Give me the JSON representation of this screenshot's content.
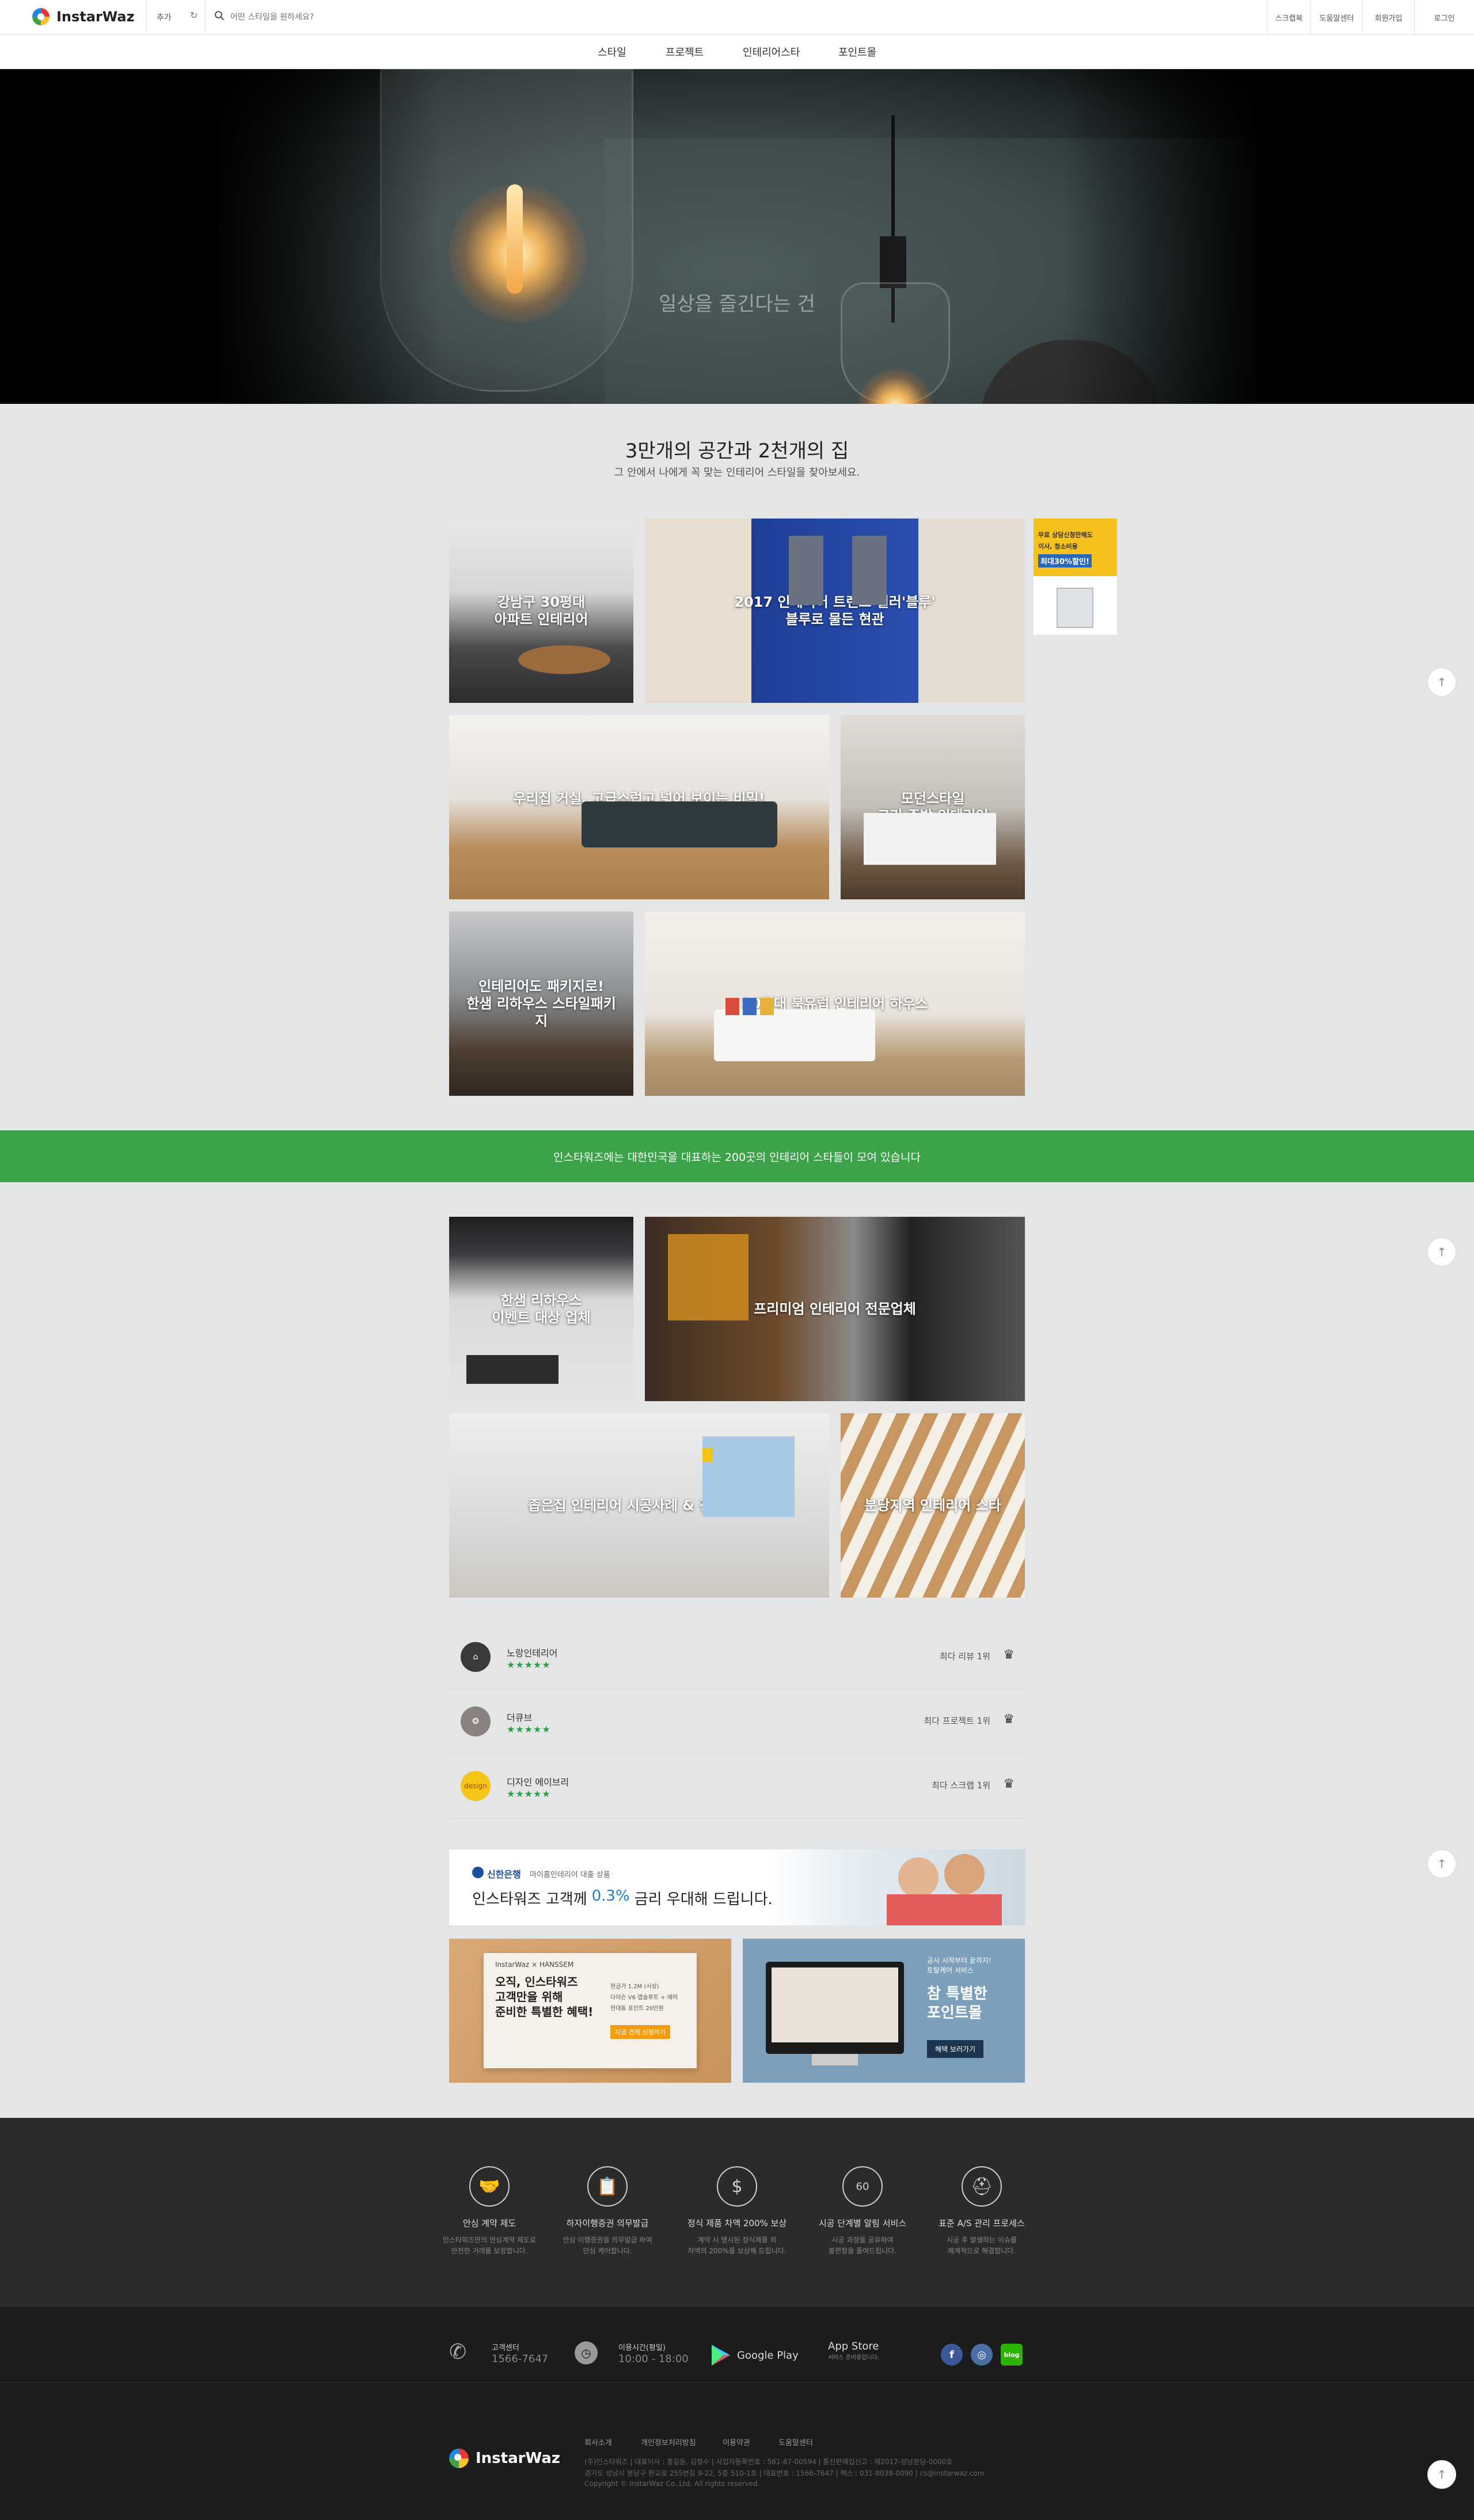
{
  "header": {
    "logo_text": "InstarWaz",
    "recent_label": "추가",
    "refresh_icon": "↻",
    "search_placeholder": "어떤 스타일을 원하세요?",
    "util_links": [
      "스크랩북",
      "도움말센터",
      "회원가입",
      "로그인"
    ]
  },
  "nav": {
    "items": [
      "스타일",
      "프로젝트",
      "인테리어스타",
      "포인트몰"
    ]
  },
  "hero": {
    "text": "일상을 즐긴다는 건"
  },
  "section1": {
    "title": "3만개의 공간과 2천개의 집",
    "subtitle": "그 안에서 나에게 꼭 맞는 인테리어 스타일을 찾아보세요."
  },
  "style_tiles": [
    {
      "label": "강남구 30평대\n아파트 인테리어"
    },
    {
      "label": "2017 인테리어 트렌드 컬러'블루'\n블루로 물든 현관"
    },
    {
      "label": "우리집 거실, 고급스럽고 넓어 보이는 비밀!\n헤링본 마루스타일"
    },
    {
      "label": "모던스타일\n고기 주방 인테리어"
    },
    {
      "label": "인테리어도 패키지로!\n한샘 리하우스 스타일패키지"
    },
    {
      "label": "20평대 북유럽 인테리어 하우스"
    }
  ],
  "side_ad": {
    "line1": "무료 상담신청만해도",
    "line2": "이사, 청소비용",
    "line3": "최대30%할인!"
  },
  "green_banner": {
    "text": "인스타워즈에는 대한민국을 대표하는 200곳의 인테리어 스타들이 모여 있습니다"
  },
  "star_tiles": [
    {
      "label": "한샘 리하우스\n이벤트 대상 업체"
    },
    {
      "label": "프리미엄 인테리어 전문업체"
    },
    {
      "label": "좁은집 인테리어 시공사례 & 전문업체"
    },
    {
      "label": "분당지역 인테리어 스타"
    }
  ],
  "rankings": [
    {
      "name": "노랑인테리어",
      "stars": "★★★★★",
      "info": "최다 리뷰 1위",
      "avatar": "⌂",
      "avatar_color": "#3a3a3a"
    },
    {
      "name": "더큐브",
      "stars": "★★★★★",
      "info": "최다 프로젝트 1위",
      "avatar": "❂",
      "avatar_color": "#8a8281"
    },
    {
      "name": "디자인 에이브리",
      "stars": "★★★★★",
      "info": "최다 스크랩 1위",
      "avatar": "design",
      "avatar_color": "#f5c518"
    }
  ],
  "bank_banner": {
    "bank_name": "신한은행",
    "bank_desc": "마이홈인테리어 대출 상품",
    "headline_pre": "인스타워즈 고객께",
    "headline_rate": "0.3%",
    "headline_post": "금리 우대해 드립니다."
  },
  "promo_left": {
    "brand": "InstarWaz × HANSSEM",
    "headline": "오직, 인스타워즈\n고객만을 위해\n준비한 특별한 혜택!",
    "bullets": [
      "현금가 1.2M (시상)",
      "다이슨 V6 앱솔루트 + 에어",
      "현대동 포인트 20만원"
    ],
    "cta": "지금 견적 신청하기"
  },
  "promo_right": {
    "small": "공사 시작부터 끝까지!\n토탈케어 서비스",
    "headline": "참 특별한\n포인트몰",
    "cta": "혜택 보러가기"
  },
  "features": [
    {
      "icon": "handshake-icon",
      "glyph": "🤝",
      "title": "안심 계약 제도",
      "desc": "인스타워즈만의 안심계약 제도로\n안전한 거래를 보장합니다."
    },
    {
      "icon": "clipboard-icon",
      "glyph": "📋",
      "title": "하자이행증권 의무발급",
      "desc": "안심 이행증권을 의무발급 하여\n안심 케어합니다."
    },
    {
      "icon": "money-hand-icon",
      "glyph": "$",
      "title": "정식 제품 차액 200% 보상",
      "desc": "계약 시 명시된 정식제품 외\n차액의 200%를 보상해 드립니다."
    },
    {
      "icon": "stopwatch-icon",
      "glyph": "60",
      "title": "시공 단계별 알림 서비스",
      "desc": "시공 과정을 공유하여\n불편함을 줄여드립니다."
    },
    {
      "icon": "worker-icon",
      "glyph": "⛑",
      "title": "표준 A/S 관리 프로세스",
      "desc": "시공 후 발생하는 이슈를\n체계적으로 해결합니다."
    }
  ],
  "contact": {
    "phone_label": "고객센터",
    "phone_number": "1566-7647",
    "hours_label": "이용시간(평일)",
    "hours_value": "10:00 - 18:00",
    "google_play": "Google Play",
    "app_store": "App Store",
    "app_store_sub": "서비스 준비중입니다."
  },
  "social": [
    {
      "icon": "facebook-icon",
      "glyph": "f",
      "color": "#3b5998"
    },
    {
      "icon": "instagram-icon",
      "glyph": "◎",
      "color": "#4a6fa5"
    },
    {
      "icon": "naver-blog-icon",
      "glyph": "blog",
      "color": "#2db400"
    }
  ],
  "footer": {
    "logo_text": "InstarWaz",
    "links": [
      "회사소개",
      "개인정보처리방침",
      "이용약관",
      "도움말센터"
    ],
    "company_line1": "(주)인스타워즈 | 대표이사 : 홍길동, 김철수 | 사업자등록번호 : 561-87-00594 | 통신판매업신고 : 제2017-성남분당-0000호",
    "company_line2": "경기도 성남시 분당구 판교로 255번길 9-22, 5층 510-1호 | 대표번호 : 1566-7647 | 팩스 : 031-8038-0090 | cs@instarwaz.com",
    "copyright": "Copyright © InstarWaz Co.,Ltd. All rights reserved."
  },
  "colors": {
    "accent_green": "#3ca34a",
    "star_green": "#2e9e46",
    "footer_dark": "#2b2b2b",
    "footer_darker": "#1c1c1c"
  }
}
